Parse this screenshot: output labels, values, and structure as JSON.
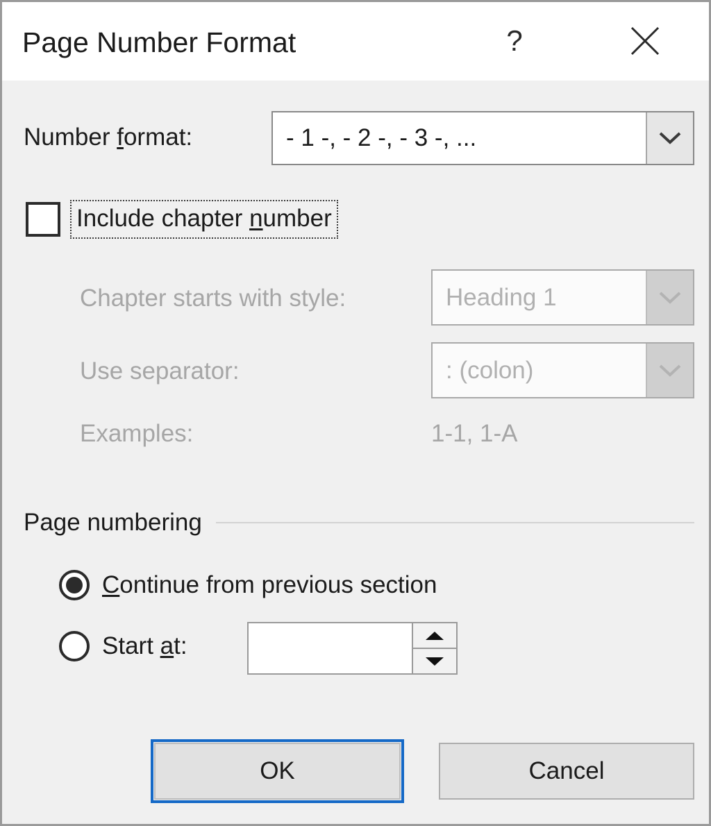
{
  "window": {
    "title": "Page Number Format",
    "help_icon": "question-mark-icon",
    "close_icon": "close-icon"
  },
  "number_format": {
    "label": "Number format:",
    "label_prefix": "Number ",
    "label_accel": "f",
    "label_suffix": "ormat:",
    "value": "- 1 -, - 2 -, - 3 -, ...",
    "dropdown_icon": "chevron-down-icon"
  },
  "include_chapter_number": {
    "label_prefix": "Include chapter ",
    "label_accel": "n",
    "label_suffix": "umber",
    "checked": false
  },
  "chapter_style": {
    "label": "Chapter starts with style:",
    "value": "Heading 1",
    "enabled": false,
    "dropdown_icon": "chevron-down-icon"
  },
  "separator": {
    "label": "Use separator:",
    "value": ":   (colon)",
    "enabled": false,
    "dropdown_icon": "chevron-down-icon"
  },
  "examples": {
    "label": "Examples:",
    "value": "1-1, 1-A"
  },
  "page_numbering": {
    "group_title": "Page numbering",
    "continue_option": {
      "label_prefix": "",
      "label_accel": "C",
      "label_suffix": "ontinue from previous section",
      "selected": true
    },
    "start_at_option": {
      "label_prefix": "Start ",
      "label_accel": "a",
      "label_suffix": "t:",
      "selected": false,
      "value": "",
      "spin_up_icon": "triangle-up-icon",
      "spin_down_icon": "triangle-down-icon"
    }
  },
  "footer": {
    "ok_label": "OK",
    "cancel_label": "Cancel"
  },
  "colors": {
    "dialog_background": "#f0f0f0",
    "titlebar_background": "#ffffff",
    "text": "#1b1b1b",
    "disabled_text": "#b0b0b0",
    "default_button_focus": "#1569c7",
    "button_face": "#e1e1e1"
  }
}
